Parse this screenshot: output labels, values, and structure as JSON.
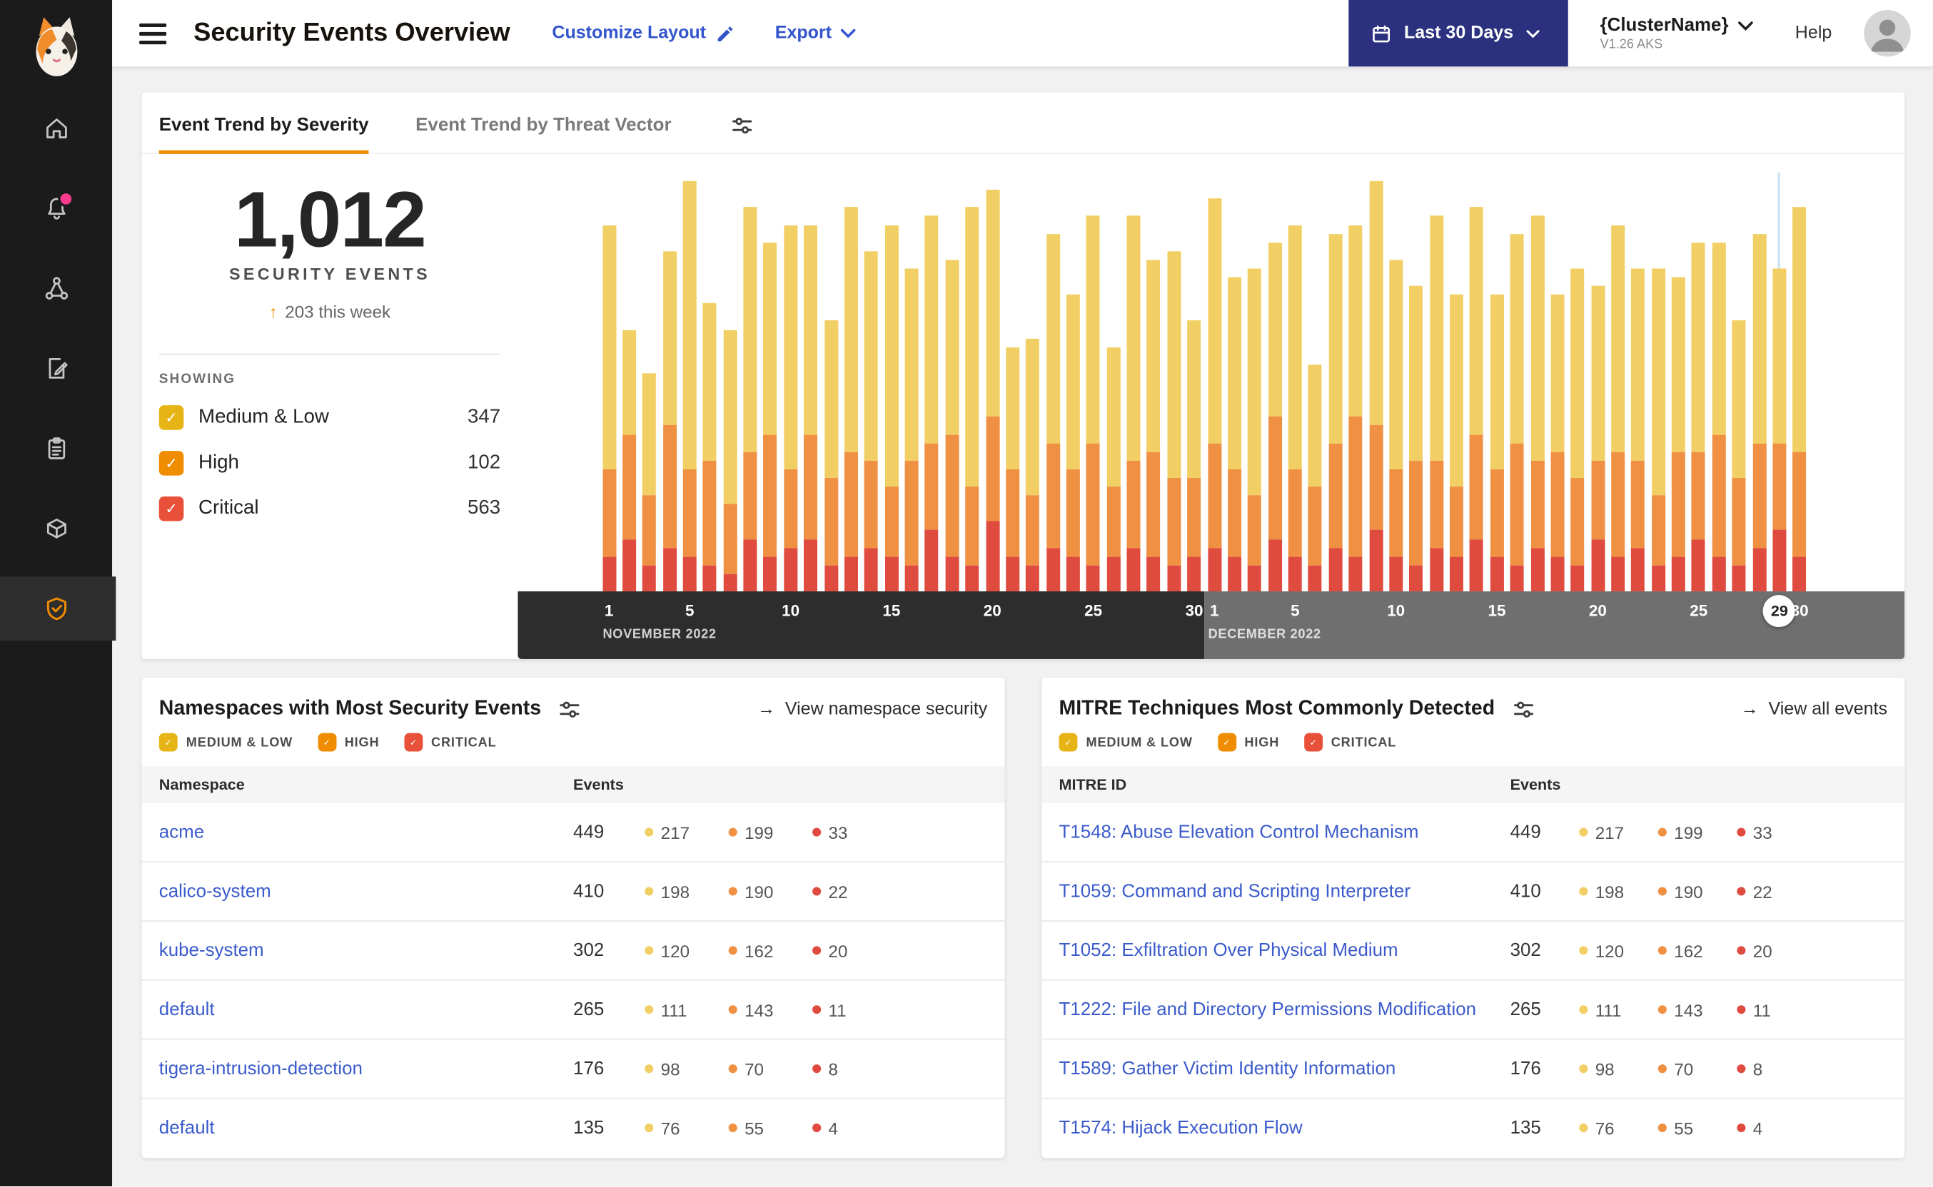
{
  "icons": {
    "check": "✓",
    "arrow_right": "→",
    "arrow_up": "↑"
  },
  "severity_colors": {
    "medium": "#f2cf65",
    "high": "#ef9043",
    "critical": "#df4b3f"
  },
  "header": {
    "title": "Security Events Overview",
    "customize_layout_label": "Customize Layout",
    "export_label": "Export",
    "date_range_label": "Last 30 Days",
    "cluster_name": "{ClusterName}",
    "cluster_version": "V1.26 AKS",
    "help_label": "Help"
  },
  "tabs": [
    {
      "label": "Event Trend by Severity",
      "active": true
    },
    {
      "label": "Event Trend by Threat Vector",
      "active": false
    }
  ],
  "summary": {
    "total": "1,012",
    "total_label": "SECURITY EVENTS",
    "delta_text": "203 this week",
    "showing_label": "SHOWING",
    "filters": [
      {
        "label": "Medium & Low",
        "count": "347",
        "color": "#e7b416"
      },
      {
        "label": "High",
        "count": "102",
        "color": "#f08c00"
      },
      {
        "label": "Critical",
        "count": "563",
        "color": "#e8503a"
      }
    ]
  },
  "chart_data": {
    "type": "bar",
    "stacked": true,
    "title": "Event Trend by Severity",
    "ylim": [
      0,
      50
    ],
    "grid": false,
    "legend_position": "left-panel",
    "tick_days": [
      1,
      5,
      10,
      15,
      20,
      25,
      30
    ],
    "months": [
      {
        "label": "NOVEMBER 2022",
        "days": 30
      },
      {
        "label": "DECEMBER 2022",
        "days": 30
      }
    ],
    "highlight": {
      "month_index": 1,
      "day": 29
    },
    "series": [
      {
        "name": "Critical",
        "color": "#df4b3f",
        "values": [
          4,
          6,
          3,
          5,
          4,
          3,
          2,
          6,
          4,
          5,
          6,
          3,
          4,
          5,
          4,
          3,
          7,
          4,
          3,
          8,
          4,
          3,
          5,
          4,
          3,
          4,
          5,
          4,
          3,
          4,
          5,
          4,
          3,
          6,
          4,
          3,
          5,
          4,
          7,
          4,
          3,
          5,
          4,
          6,
          4,
          3,
          5,
          4,
          3,
          6,
          4,
          5,
          3,
          4,
          6,
          4,
          3,
          5,
          7,
          4
        ]
      },
      {
        "name": "High",
        "color": "#ef9043",
        "values": [
          10,
          12,
          8,
          14,
          10,
          12,
          8,
          10,
          14,
          9,
          12,
          10,
          12,
          10,
          8,
          12,
          10,
          14,
          9,
          12,
          10,
          8,
          12,
          10,
          14,
          8,
          10,
          12,
          10,
          9,
          12,
          10,
          8,
          14,
          10,
          9,
          12,
          16,
          12,
          10,
          12,
          10,
          8,
          12,
          10,
          14,
          10,
          12,
          10,
          9,
          12,
          10,
          8,
          12,
          10,
          14,
          10,
          12,
          10,
          12
        ]
      },
      {
        "name": "Medium & Low",
        "color": "#f2cf65",
        "values": [
          28,
          12,
          14,
          20,
          33,
          18,
          20,
          28,
          22,
          28,
          24,
          18,
          28,
          24,
          30,
          22,
          26,
          20,
          32,
          26,
          14,
          18,
          24,
          20,
          26,
          16,
          28,
          22,
          26,
          18,
          28,
          22,
          26,
          20,
          28,
          14,
          24,
          22,
          28,
          24,
          20,
          28,
          22,
          26,
          20,
          24,
          28,
          18,
          24,
          20,
          26,
          22,
          26,
          20,
          24,
          22,
          18,
          24,
          20,
          28
        ]
      }
    ]
  },
  "namespaces_card": {
    "title": "Namespaces with Most Security Events",
    "link_label": "View namespace security",
    "filters": [
      {
        "label": "MEDIUM & LOW",
        "color": "#e7b416"
      },
      {
        "label": "HIGH",
        "color": "#f08c00"
      },
      {
        "label": "CRITICAL",
        "color": "#e8503a"
      }
    ],
    "columns": [
      "Namespace",
      "Events"
    ],
    "rows": [
      {
        "name": "acme",
        "total": "449",
        "medium": "217",
        "high": "199",
        "critical": "33"
      },
      {
        "name": "calico-system",
        "total": "410",
        "medium": "198",
        "high": "190",
        "critical": "22"
      },
      {
        "name": "kube-system",
        "total": "302",
        "medium": "120",
        "high": "162",
        "critical": "20"
      },
      {
        "name": "default",
        "total": "265",
        "medium": "111",
        "high": "143",
        "critical": "11"
      },
      {
        "name": "tigera-intrusion-detection",
        "total": "176",
        "medium": "98",
        "high": "70",
        "critical": "8"
      },
      {
        "name": "default",
        "total": "135",
        "medium": "76",
        "high": "55",
        "critical": "4"
      }
    ]
  },
  "mitre_card": {
    "title": "MITRE Techniques Most Commonly Detected",
    "link_label": "View all events",
    "filters": [
      {
        "label": "MEDIUM & LOW",
        "color": "#e7b416"
      },
      {
        "label": "HIGH",
        "color": "#f08c00"
      },
      {
        "label": "CRITICAL",
        "color": "#e8503a"
      }
    ],
    "columns": [
      "MITRE ID",
      "Events"
    ],
    "rows": [
      {
        "name": "T1548: Abuse Elevation Control Mechanism",
        "total": "449",
        "medium": "217",
        "high": "199",
        "critical": "33"
      },
      {
        "name": "T1059: Command and Scripting Interpreter",
        "total": "410",
        "medium": "198",
        "high": "190",
        "critical": "22"
      },
      {
        "name": "T1052: Exfiltration Over Physical Medium",
        "total": "302",
        "medium": "120",
        "high": "162",
        "critical": "20"
      },
      {
        "name": "T1222: File and Directory Permissions Modification",
        "total": "265",
        "medium": "111",
        "high": "143",
        "critical": "11"
      },
      {
        "name": "T1589: Gather Victim Identity Information",
        "total": "176",
        "medium": "98",
        "high": "70",
        "critical": "8"
      },
      {
        "name": "T1574: Hijack Execution Flow",
        "total": "135",
        "medium": "76",
        "high": "55",
        "critical": "4"
      }
    ]
  }
}
